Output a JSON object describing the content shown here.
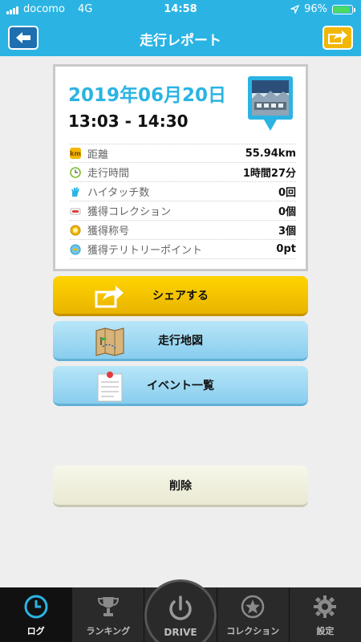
{
  "status": {
    "carrier": "docomo",
    "network": "4G",
    "time": "14:58",
    "battery": "96%"
  },
  "header": {
    "title": "走行レポート"
  },
  "report": {
    "date": "2019年06月20日",
    "time_range": "13:03 - 14:30",
    "stats": [
      {
        "label": "距離",
        "value": "55.94km",
        "icon": "km-icon"
      },
      {
        "label": "走行時間",
        "value": "1時間27分",
        "icon": "clock-icon"
      },
      {
        "label": "ハイタッチ数",
        "value": "0回",
        "icon": "hand-icon"
      },
      {
        "label": "獲得コレクション",
        "value": "0個",
        "icon": "car-icon"
      },
      {
        "label": "獲得称号",
        "value": "3個",
        "icon": "medal-icon"
      },
      {
        "label": "獲得テリトリーポイント",
        "value": "0pt",
        "icon": "territory-icon"
      }
    ]
  },
  "buttons": {
    "share": "シェアする",
    "map": "走行地図",
    "events": "イベント一覧",
    "delete": "削除"
  },
  "tabs": {
    "log": "ログ",
    "ranking": "ランキング",
    "drive": "DRIVE",
    "collection": "コレクション",
    "settings": "設定"
  },
  "colors": {
    "accent": "#2bb4e3",
    "share": "#ffd400",
    "map": "#9fd9f3"
  }
}
